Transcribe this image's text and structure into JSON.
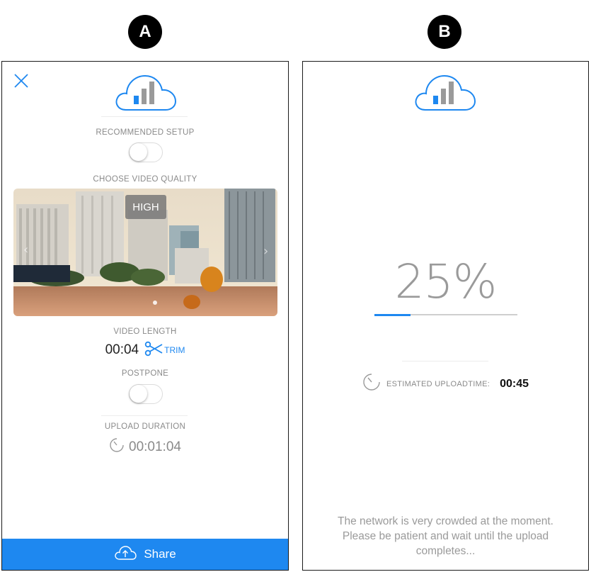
{
  "panel_labels": {
    "a": "A",
    "b": "B"
  },
  "colors": {
    "accent": "#1e88f0",
    "muted": "#8a8a8a",
    "bar_gray": "#9a9a9a"
  },
  "screen_a": {
    "close_icon": "close-icon",
    "cloud_icon": "cloud-signal-icon",
    "recommended_setup": {
      "label": "RECOMMENDED SETUP",
      "enabled": false
    },
    "video_quality": {
      "label": "CHOOSE VIDEO QUALITY",
      "selected": "HIGH"
    },
    "video_length": {
      "label": "VIDEO LENGTH",
      "value": "00:04",
      "trim_label": "TRIM"
    },
    "postpone": {
      "label": "POSTPONE",
      "enabled": false
    },
    "upload_duration": {
      "label": "UPLOAD DURATION",
      "value": "00:01:04"
    },
    "share_button": {
      "label": "Share"
    }
  },
  "screen_b": {
    "cloud_icon": "cloud-signal-icon",
    "progress": {
      "percent_text": "25%",
      "fraction": 0.25
    },
    "estimated": {
      "label": "ESTIMATED UPLOADTIME:",
      "value": "00:45"
    },
    "message_lines": [
      "The network is very crowded at the moment.",
      "Please be patient and wait until the upload",
      "completes..."
    ]
  }
}
